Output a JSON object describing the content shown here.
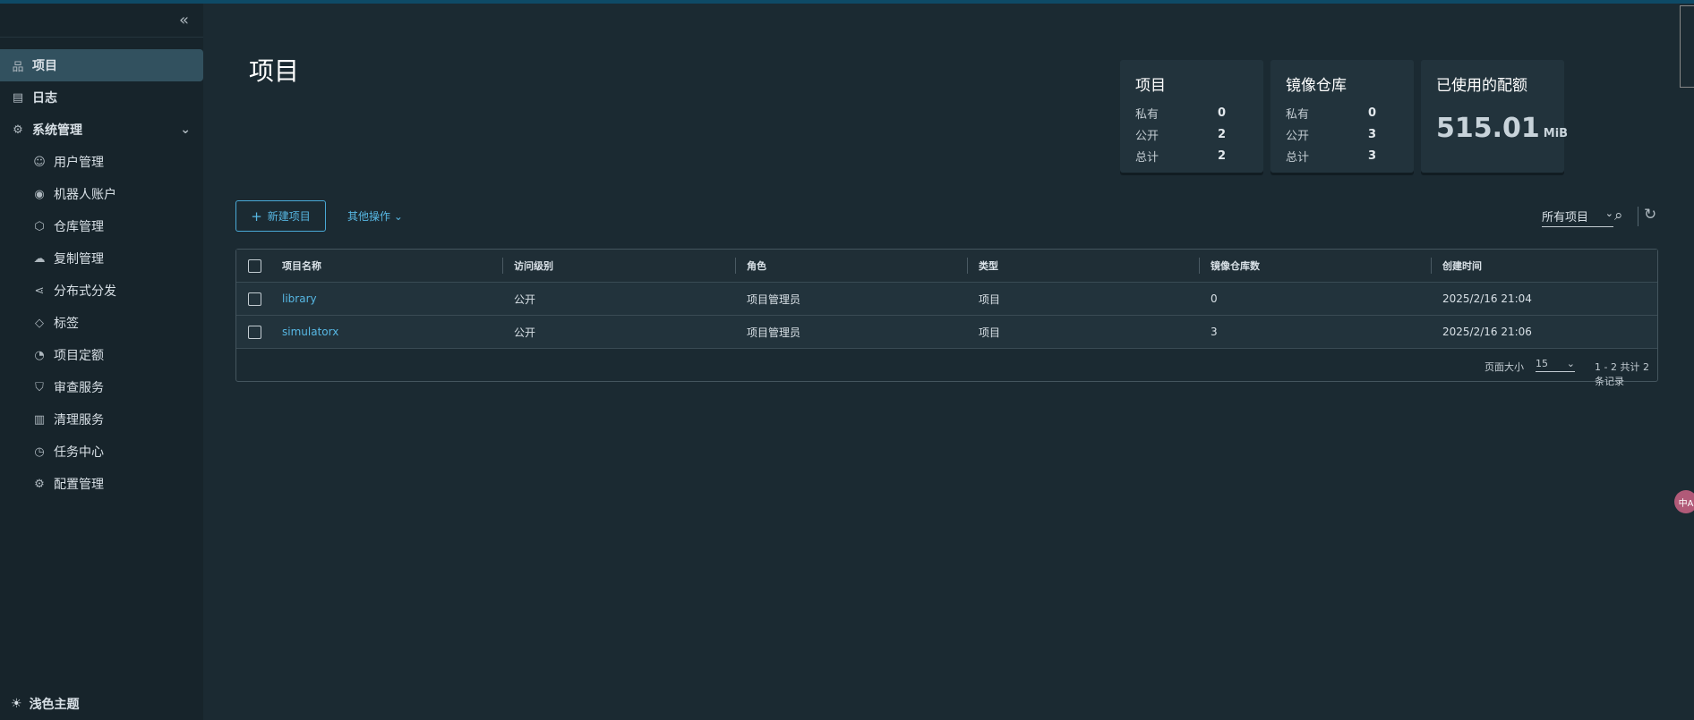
{
  "sidebar": {
    "collapse_icon": "double-chevron-left",
    "items": [
      {
        "label": "项目",
        "icon": "network-icon",
        "active": true
      },
      {
        "label": "日志",
        "icon": "list-icon"
      },
      {
        "label": "系统管理",
        "icon": "users-gear-icon",
        "expanded": true
      }
    ],
    "sub_items": [
      {
        "label": "用户管理",
        "icon": "users-icon"
      },
      {
        "label": "机器人账户",
        "icon": "robot-icon"
      },
      {
        "label": "仓库管理",
        "icon": "cube-icon"
      },
      {
        "label": "复制管理",
        "icon": "cloud-icon"
      },
      {
        "label": "分布式分发",
        "icon": "share-icon"
      },
      {
        "label": "标签",
        "icon": "tag-icon"
      },
      {
        "label": "项目定额",
        "icon": "gauge-icon"
      },
      {
        "label": "审查服务",
        "icon": "shield-icon"
      },
      {
        "label": "清理服务",
        "icon": "trash-icon"
      },
      {
        "label": "任务中心",
        "icon": "dashboard-icon"
      },
      {
        "label": "配置管理",
        "icon": "gear-icon"
      }
    ],
    "theme_label": "浅色主题"
  },
  "main": {
    "title": "项目",
    "cards": [
      {
        "title": "项目",
        "rows": [
          {
            "k": "私有",
            "v": "0"
          },
          {
            "k": "公开",
            "v": "2"
          },
          {
            "k": "总计",
            "v": "2"
          }
        ]
      },
      {
        "title": "镜像仓库",
        "rows": [
          {
            "k": "私有",
            "v": "0"
          },
          {
            "k": "公开",
            "v": "3"
          },
          {
            "k": "总计",
            "v": "3"
          }
        ]
      }
    ],
    "quota": {
      "title": "已使用的配额",
      "value": "515.01",
      "unit": "MiB"
    },
    "new_project": "新建项目",
    "more_actions": "其他操作",
    "filter": "所有项目",
    "table": {
      "headers": [
        "项目名称",
        "访问级别",
        "角色",
        "类型",
        "镜像仓库数",
        "创建时间"
      ],
      "rows": [
        [
          "library",
          "公开",
          "项目管理员",
          "项目",
          "0",
          "2025/2/16 21:04"
        ],
        [
          "simulatorx",
          "公开",
          "项目管理员",
          "项目",
          "3",
          "2025/2/16 21:06"
        ]
      ],
      "page_size_label": "页面大小",
      "page_size": "15",
      "count_text": "1 - 2 共计 2 条记录"
    }
  },
  "colors": {
    "accent": "#57b7e3",
    "active_nav": "#32515f",
    "background": "#1b2a32"
  }
}
